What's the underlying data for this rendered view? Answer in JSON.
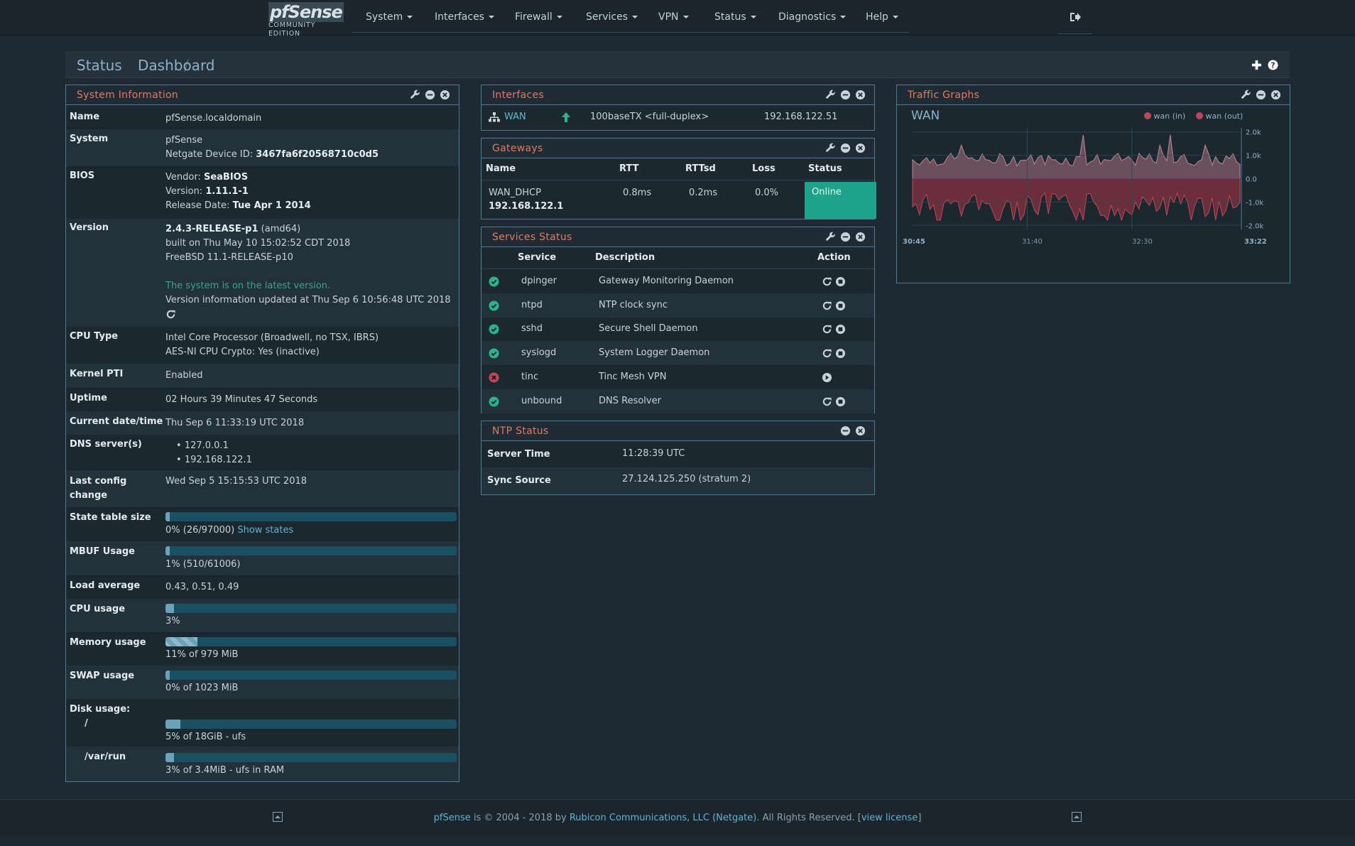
{
  "brand": {
    "logo": "pfSense",
    "edition": "COMMUNITY EDITION"
  },
  "nav": [
    "System",
    "Interfaces",
    "Firewall",
    "Services",
    "VPN",
    "Status",
    "Diagnostics",
    "Help"
  ],
  "breadcrumb": {
    "section": "Status",
    "page": "Dashboard"
  },
  "sysinfo": {
    "title": "System Information",
    "rows": [
      {
        "label": "Name",
        "lines": [
          "pfSense.localdomain"
        ]
      },
      {
        "label": "System",
        "lines": [
          "pfSense",
          "Netgate Device ID:",
          "3467fa6f20568710c0d5"
        ]
      },
      {
        "label": "BIOS",
        "vendor_lbl": "Vendor:",
        "vendor": "SeaBIOS",
        "version_lbl": "Version:",
        "version": "1.11.1-1",
        "date_lbl": "Release Date:",
        "date": "Tue Apr 1 2014"
      },
      {
        "label": "Version",
        "rel": "2.4.3-RELEASE-p1",
        "arch": "(amd64)",
        "built": "built on Thu May 10 15:02:52 CDT 2018",
        "os": "FreeBSD 11.1-RELEASE-p10",
        "latest": "The system is on the latest version.",
        "updated": "Version information updated at Thu Sep 6 10:56:48 UTC 2018"
      },
      {
        "label": "CPU Type",
        "l1": "Intel Core Processor (Broadwell, no TSX, IBRS)",
        "l2": "AES-NI CPU Crypto: Yes (inactive)"
      },
      {
        "label": "Kernel PTI",
        "val": "Enabled"
      },
      {
        "label": "Uptime",
        "val": "02 Hours 39 Minutes 47 Seconds"
      },
      {
        "label": "Current date/time",
        "val": "Thu Sep 6 11:33:19 UTC 2018"
      },
      {
        "label": "DNS server(s)",
        "dns": [
          "127.0.0.1",
          "192.168.122.1"
        ]
      },
      {
        "label": "Last config change",
        "val": "Wed Sep 5 15:15:53 UTC 2018"
      },
      {
        "label": "State table size",
        "val": "0% (26/97000)",
        "link": "Show states",
        "pct": 0
      },
      {
        "label": "MBUF Usage",
        "val": "1% (510/61006)",
        "pct": 1
      },
      {
        "label": "Load average",
        "val": "0.43, 0.51, 0.49"
      },
      {
        "label": "CPU usage",
        "val": "3%",
        "pct": 3
      },
      {
        "label": "Memory usage",
        "val": "11% of 979 MiB",
        "pct": 11
      },
      {
        "label": "SWAP usage",
        "val": "0% of 1023 MiB",
        "pct": 0
      },
      {
        "label": "Disk usage:",
        "mount": "/",
        "val": "5% of 18GiB - ufs",
        "pct": 5
      },
      {
        "label": "/var/run",
        "val": "3% of 3.4MiB - ufs in RAM",
        "pct": 3
      }
    ]
  },
  "interfaces": {
    "title": "Interfaces",
    "name": "WAN",
    "media": "100baseTX <full-duplex>",
    "ip": "192.168.122.51"
  },
  "gateways": {
    "title": "Gateways",
    "headers": [
      "Name",
      "RTT",
      "RTTsd",
      "Loss",
      "Status"
    ],
    "name": "WAN_DHCP",
    "ip": "192.168.122.1",
    "rtt": "0.8ms",
    "rttsd": "0.2ms",
    "loss": "0.0%",
    "status": "Online"
  },
  "services": {
    "title": "Services Status",
    "headers": [
      "Service",
      "Description",
      "Action"
    ],
    "rows": [
      {
        "name": "dpinger",
        "desc": "Gateway Monitoring Daemon",
        "running": true
      },
      {
        "name": "ntpd",
        "desc": "NTP clock sync",
        "running": true
      },
      {
        "name": "sshd",
        "desc": "Secure Shell Daemon",
        "running": true
      },
      {
        "name": "syslogd",
        "desc": "System Logger Daemon",
        "running": true
      },
      {
        "name": "tinc",
        "desc": "Tinc Mesh VPN",
        "running": false
      },
      {
        "name": "unbound",
        "desc": "DNS Resolver",
        "running": true
      }
    ]
  },
  "ntp": {
    "title": "NTP Status",
    "server_time_lbl": "Server Time",
    "server_time": "11:28:39 UTC",
    "sync_lbl": "Sync Source",
    "sync": "27.124.125.250 (stratum 2)"
  },
  "traffic": {
    "title": "Traffic Graphs",
    "iface": "WAN",
    "legend_in": "wan (in)",
    "legend_out": "wan (out)",
    "color_in": "#c0475a",
    "color_out": "#c0475a",
    "yticks": [
      "2.0k",
      "1.0k",
      "0.0",
      "-1.0k",
      "-2.0k"
    ],
    "xticks": [
      "30:45",
      "31:40",
      "32:30",
      "33:22"
    ]
  },
  "chart_data": {
    "type": "area",
    "title": "WAN",
    "series": [
      {
        "name": "wan (in)"
      },
      {
        "name": "wan (out)"
      }
    ],
    "yticks": [
      "2.0k",
      "1.0k",
      "0.0",
      "-1.0k",
      "-2.0k"
    ],
    "xticks": [
      "30:45",
      "31:40",
      "32:30",
      "33:22"
    ],
    "ylim": [
      -2000,
      2000
    ]
  },
  "footer": {
    "p1": "pfSense",
    "p2": " is © 2004 - 2018 by ",
    "p3": "Rubicon Communications, LLC (Netgate)",
    "p4": ". All Rights Reserved. [",
    "p5": "view license",
    "p6": "]"
  }
}
